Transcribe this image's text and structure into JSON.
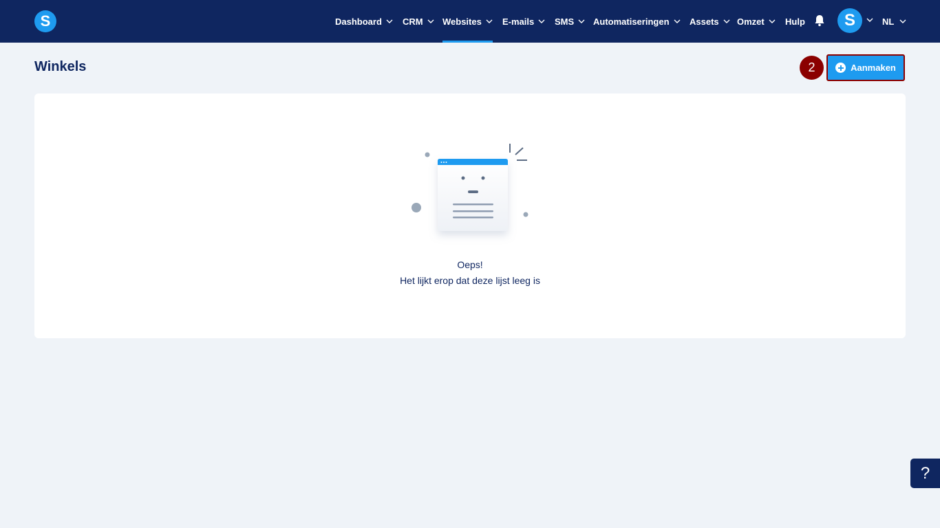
{
  "header": {
    "logo_letter": "S",
    "nav": [
      {
        "label": "Dashboard",
        "dropdown": true,
        "active": false
      },
      {
        "label": "CRM",
        "dropdown": true,
        "active": false
      },
      {
        "label": "Websites",
        "dropdown": true,
        "active": true
      },
      {
        "label": "E-mails",
        "dropdown": true,
        "active": false
      },
      {
        "label": "SMS",
        "dropdown": true,
        "active": false
      },
      {
        "label": "Automatiseringen",
        "dropdown": true,
        "active": false
      },
      {
        "label": "Assets",
        "dropdown": true,
        "active": false
      },
      {
        "label": "Omzet",
        "dropdown": true,
        "active": false
      },
      {
        "label": "Hulp",
        "dropdown": false,
        "active": false
      }
    ],
    "avatar_letter": "S",
    "language": "NL"
  },
  "page": {
    "title": "Winkels",
    "step_number": "2",
    "create_label": "Aanmaken"
  },
  "empty_state": {
    "title": "Oeps!",
    "subtitle": "Het lijkt erop dat deze lijst leeg is"
  },
  "help": {
    "label": "?"
  },
  "colors": {
    "navy": "#0f2660",
    "accent": "#1e9bf0",
    "background": "#eff3f8",
    "highlight": "#8b0000"
  }
}
